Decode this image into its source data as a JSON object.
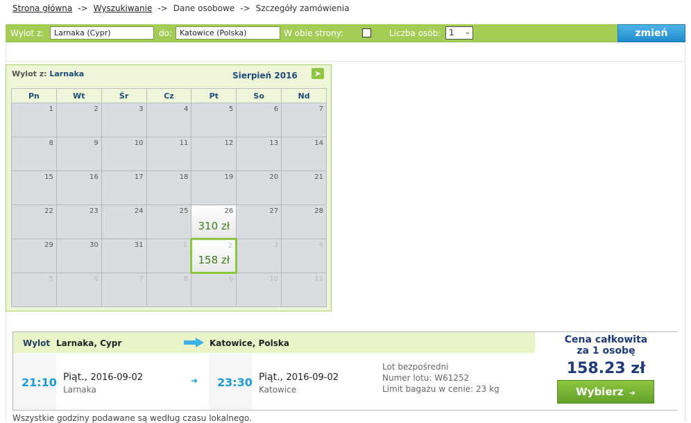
{
  "breadcrumb": {
    "items": [
      "Strona główna",
      "Wyszukiwanie",
      "Dane osobowe",
      "Szczegóły zamówienia"
    ],
    "separator": "->"
  },
  "search": {
    "from_label": "Wylot z:",
    "from_value": "Larnaka (Cypr)",
    "to_label": "do:",
    "to_value": "Katowice (Polska)",
    "roundtrip_label": "W obie strony:",
    "roundtrip_checked": false,
    "passengers_label": "Liczba osób:",
    "passengers_value": "1",
    "change_button": "zmień"
  },
  "calendar": {
    "from_label": "Wylot z:",
    "from_city": "Larnaka",
    "month": "Sierpień 2016",
    "next_icon": "arrow-right-icon",
    "weekdays": [
      "Pn",
      "Wt",
      "Śr",
      "Cz",
      "Pt",
      "So",
      "Nd"
    ],
    "rows": [
      [
        "1",
        "2",
        "3",
        "4",
        "5",
        "6",
        "7"
      ],
      [
        "8",
        "9",
        "10",
        "11",
        "12",
        "13",
        "14"
      ],
      [
        "15",
        "16",
        "17",
        "18",
        "19",
        "20",
        "21"
      ],
      [
        "22",
        "23",
        "24",
        "25",
        "26",
        "27",
        "28"
      ],
      [
        "29",
        "30",
        "31",
        "1",
        "2",
        "3",
        "4"
      ],
      [
        "5",
        "6",
        "7",
        "8",
        "9",
        "10",
        "11"
      ]
    ],
    "price_26": "310 zł",
    "price_2": "158 zł"
  },
  "flight": {
    "label": "Wylot",
    "from": "Larnaka, Cypr",
    "to": "Katowice, Polska",
    "dep_time": "21:10",
    "dep_day": "Piąt.,",
    "dep_date": "2016-09-02",
    "dep_city": "Larnaka",
    "arr_time": "23:30",
    "arr_day": "Piąt.,",
    "arr_date": "2016-09-02",
    "arr_city": "Katowice",
    "info_direct": "Lot bezpośredni",
    "info_flight_no": "Numer lotu: W61252",
    "info_baggage": "Limit bagażu w cenie: 23 kg",
    "total_label_1": "Cena całkowita",
    "total_label_2": "za 1 osobę",
    "total_price": "158.23 zł",
    "choose_button": "Wybierz"
  },
  "footnote": "Wszystkie godziny podawane są według czasu lokalnego.",
  "colors": {
    "accent_green": "#a3cc55",
    "button_blue": "#1e8ccc",
    "time_blue": "#1c9ad6",
    "title_navy": "#1f3b7a"
  }
}
